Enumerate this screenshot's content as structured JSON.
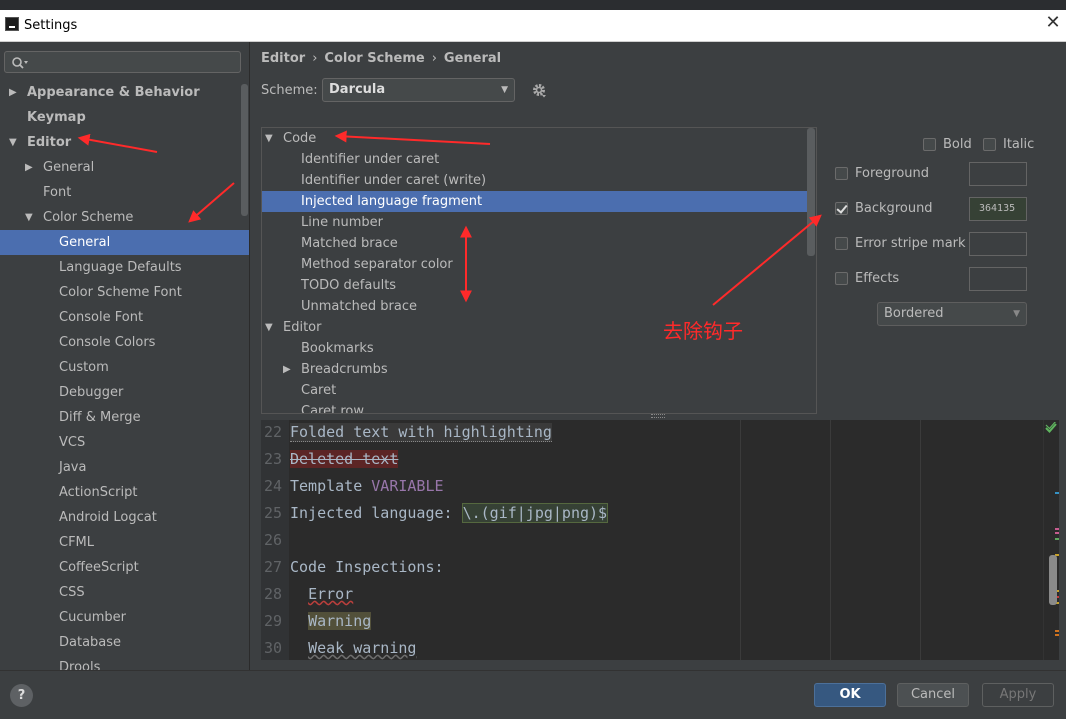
{
  "window": {
    "title": "Settings",
    "close_glyph": "✕"
  },
  "search": {
    "icon": "search-icon"
  },
  "sidebar": {
    "items": [
      {
        "label": "Appearance & Behavior",
        "level": 0,
        "expander": "collapsed",
        "bold": true,
        "selected": false
      },
      {
        "label": "Keymap",
        "level": 0,
        "expander": "none",
        "bold": true,
        "selected": false
      },
      {
        "label": "Editor",
        "level": 0,
        "expander": "expanded",
        "bold": true,
        "selected": false
      },
      {
        "label": "General",
        "level": 1,
        "expander": "collapsed",
        "bold": false,
        "selected": false
      },
      {
        "label": "Font",
        "level": 1,
        "expander": "none",
        "bold": false,
        "selected": false
      },
      {
        "label": "Color Scheme",
        "level": 1,
        "expander": "expanded",
        "bold": false,
        "selected": false
      },
      {
        "label": "General",
        "level": 2,
        "expander": "none",
        "bold": false,
        "selected": true
      },
      {
        "label": "Language Defaults",
        "level": 2,
        "expander": "none",
        "bold": false,
        "selected": false
      },
      {
        "label": "Color Scheme Font",
        "level": 2,
        "expander": "none",
        "bold": false,
        "selected": false
      },
      {
        "label": "Console Font",
        "level": 2,
        "expander": "none",
        "bold": false,
        "selected": false
      },
      {
        "label": "Console Colors",
        "level": 2,
        "expander": "none",
        "bold": false,
        "selected": false
      },
      {
        "label": "Custom",
        "level": 2,
        "expander": "none",
        "bold": false,
        "selected": false
      },
      {
        "label": "Debugger",
        "level": 2,
        "expander": "none",
        "bold": false,
        "selected": false
      },
      {
        "label": "Diff & Merge",
        "level": 2,
        "expander": "none",
        "bold": false,
        "selected": false
      },
      {
        "label": "VCS",
        "level": 2,
        "expander": "none",
        "bold": false,
        "selected": false
      },
      {
        "label": "Java",
        "level": 2,
        "expander": "none",
        "bold": false,
        "selected": false
      },
      {
        "label": "ActionScript",
        "level": 2,
        "expander": "none",
        "bold": false,
        "selected": false
      },
      {
        "label": "Android Logcat",
        "level": 2,
        "expander": "none",
        "bold": false,
        "selected": false
      },
      {
        "label": "CFML",
        "level": 2,
        "expander": "none",
        "bold": false,
        "selected": false
      },
      {
        "label": "CoffeeScript",
        "level": 2,
        "expander": "none",
        "bold": false,
        "selected": false
      },
      {
        "label": "CSS",
        "level": 2,
        "expander": "none",
        "bold": false,
        "selected": false
      },
      {
        "label": "Cucumber",
        "level": 2,
        "expander": "none",
        "bold": false,
        "selected": false
      },
      {
        "label": "Database",
        "level": 2,
        "expander": "none",
        "bold": false,
        "selected": false
      },
      {
        "label": "Drools",
        "level": 2,
        "expander": "none",
        "bold": false,
        "selected": false
      }
    ]
  },
  "breadcrumb": {
    "items": [
      "Editor",
      "Color Scheme",
      "General"
    ],
    "separator": "›"
  },
  "scheme": {
    "label": "Scheme:",
    "value": "Darcula"
  },
  "element_tree": {
    "rows": [
      {
        "label": "Code",
        "level": 0,
        "expander": "expanded",
        "selected": false
      },
      {
        "label": "Identifier under caret",
        "level": 1,
        "expander": "none",
        "selected": false
      },
      {
        "label": "Identifier under caret (write)",
        "level": 1,
        "expander": "none",
        "selected": false
      },
      {
        "label": "Injected language fragment",
        "level": 1,
        "expander": "none",
        "selected": true
      },
      {
        "label": "Line number",
        "level": 1,
        "expander": "none",
        "selected": false
      },
      {
        "label": "Matched brace",
        "level": 1,
        "expander": "none",
        "selected": false
      },
      {
        "label": "Method separator color",
        "level": 1,
        "expander": "none",
        "selected": false
      },
      {
        "label": "TODO defaults",
        "level": 1,
        "expander": "none",
        "selected": false
      },
      {
        "label": "Unmatched brace",
        "level": 1,
        "expander": "none",
        "selected": false
      },
      {
        "label": "Editor",
        "level": 0,
        "expander": "expanded",
        "selected": false
      },
      {
        "label": "Bookmarks",
        "level": 1,
        "expander": "none",
        "selected": false
      },
      {
        "label": "Breadcrumbs",
        "level": 1,
        "expander": "collapsed",
        "selected": false
      },
      {
        "label": "Caret",
        "level": 1,
        "expander": "none",
        "selected": false
      },
      {
        "label": "Caret row",
        "level": 1,
        "expander": "none",
        "selected": false
      }
    ]
  },
  "attributes": {
    "bold": {
      "label": "Bold",
      "checked": false
    },
    "italic": {
      "label": "Italic",
      "checked": false
    },
    "foreground": {
      "label": "Foreground",
      "checked": false,
      "color": ""
    },
    "background": {
      "label": "Background",
      "checked": true,
      "color": "364135"
    },
    "error_stripe": {
      "label": "Error stripe mark",
      "checked": false,
      "color": ""
    },
    "effects": {
      "label": "Effects",
      "checked": false,
      "color": ""
    },
    "effect_type": "Bordered"
  },
  "preview": {
    "lines": [
      {
        "num": "22",
        "segments": [
          {
            "text": "Folded text with highlighting",
            "style": "folded"
          }
        ]
      },
      {
        "num": "23",
        "segments": [
          {
            "text": "Deleted text",
            "style": "deleted"
          }
        ]
      },
      {
        "num": "24",
        "segments": [
          {
            "text": "Template ",
            "style": "plain"
          },
          {
            "text": "VARIABLE",
            "style": "template"
          }
        ]
      },
      {
        "num": "25",
        "segments": [
          {
            "text": "Injected language: ",
            "style": "plain"
          },
          {
            "text": "\\.(gif|jpg|png)$",
            "style": "injected"
          }
        ]
      },
      {
        "num": "26",
        "segments": []
      },
      {
        "num": "27",
        "segments": [
          {
            "text": "Code Inspections:",
            "style": "plain"
          }
        ]
      },
      {
        "num": "28",
        "segments": [
          {
            "text": "  ",
            "style": "indent"
          },
          {
            "text": "Error",
            "style": "error"
          }
        ]
      },
      {
        "num": "29",
        "segments": [
          {
            "text": "  ",
            "style": "indent"
          },
          {
            "text": "Warning",
            "style": "warning"
          }
        ]
      },
      {
        "num": "30",
        "segments": [
          {
            "text": "  ",
            "style": "indent"
          },
          {
            "text": "Weak warning",
            "style": "weak"
          }
        ]
      }
    ]
  },
  "footer": {
    "help": "?",
    "ok": "OK",
    "cancel": "Cancel",
    "apply": "Apply"
  },
  "annotation": {
    "text": "去除钩子",
    "color": "#ff2a2a"
  },
  "colors": {
    "selection": "#4b6eaf",
    "background": "#3c3f41",
    "editor_bg": "#2b2b2b",
    "ok_button": "#365880"
  }
}
